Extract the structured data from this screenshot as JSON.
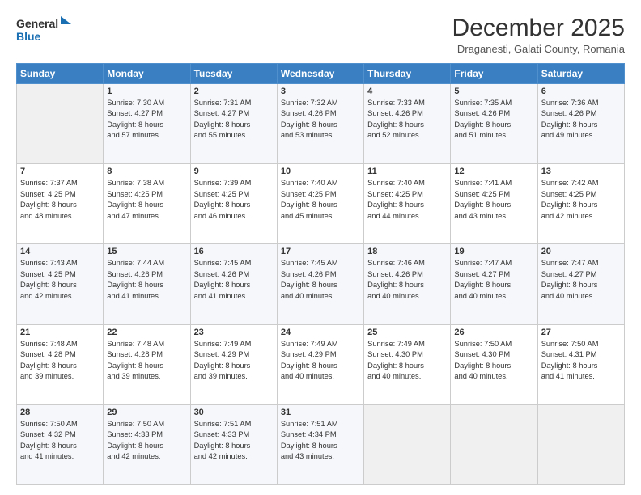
{
  "logo": {
    "line1": "General",
    "line2": "Blue"
  },
  "header": {
    "month": "December 2025",
    "location": "Draganesti, Galati County, Romania"
  },
  "weekdays": [
    "Sunday",
    "Monday",
    "Tuesday",
    "Wednesday",
    "Thursday",
    "Friday",
    "Saturday"
  ],
  "weeks": [
    [
      {
        "day": "",
        "content": ""
      },
      {
        "day": "1",
        "content": "Sunrise: 7:30 AM\nSunset: 4:27 PM\nDaylight: 8 hours\nand 57 minutes."
      },
      {
        "day": "2",
        "content": "Sunrise: 7:31 AM\nSunset: 4:27 PM\nDaylight: 8 hours\nand 55 minutes."
      },
      {
        "day": "3",
        "content": "Sunrise: 7:32 AM\nSunset: 4:26 PM\nDaylight: 8 hours\nand 53 minutes."
      },
      {
        "day": "4",
        "content": "Sunrise: 7:33 AM\nSunset: 4:26 PM\nDaylight: 8 hours\nand 52 minutes."
      },
      {
        "day": "5",
        "content": "Sunrise: 7:35 AM\nSunset: 4:26 PM\nDaylight: 8 hours\nand 51 minutes."
      },
      {
        "day": "6",
        "content": "Sunrise: 7:36 AM\nSunset: 4:26 PM\nDaylight: 8 hours\nand 49 minutes."
      }
    ],
    [
      {
        "day": "7",
        "content": "Sunrise: 7:37 AM\nSunset: 4:25 PM\nDaylight: 8 hours\nand 48 minutes."
      },
      {
        "day": "8",
        "content": "Sunrise: 7:38 AM\nSunset: 4:25 PM\nDaylight: 8 hours\nand 47 minutes."
      },
      {
        "day": "9",
        "content": "Sunrise: 7:39 AM\nSunset: 4:25 PM\nDaylight: 8 hours\nand 46 minutes."
      },
      {
        "day": "10",
        "content": "Sunrise: 7:40 AM\nSunset: 4:25 PM\nDaylight: 8 hours\nand 45 minutes."
      },
      {
        "day": "11",
        "content": "Sunrise: 7:40 AM\nSunset: 4:25 PM\nDaylight: 8 hours\nand 44 minutes."
      },
      {
        "day": "12",
        "content": "Sunrise: 7:41 AM\nSunset: 4:25 PM\nDaylight: 8 hours\nand 43 minutes."
      },
      {
        "day": "13",
        "content": "Sunrise: 7:42 AM\nSunset: 4:25 PM\nDaylight: 8 hours\nand 42 minutes."
      }
    ],
    [
      {
        "day": "14",
        "content": "Sunrise: 7:43 AM\nSunset: 4:25 PM\nDaylight: 8 hours\nand 42 minutes."
      },
      {
        "day": "15",
        "content": "Sunrise: 7:44 AM\nSunset: 4:26 PM\nDaylight: 8 hours\nand 41 minutes."
      },
      {
        "day": "16",
        "content": "Sunrise: 7:45 AM\nSunset: 4:26 PM\nDaylight: 8 hours\nand 41 minutes."
      },
      {
        "day": "17",
        "content": "Sunrise: 7:45 AM\nSunset: 4:26 PM\nDaylight: 8 hours\nand 40 minutes."
      },
      {
        "day": "18",
        "content": "Sunrise: 7:46 AM\nSunset: 4:26 PM\nDaylight: 8 hours\nand 40 minutes."
      },
      {
        "day": "19",
        "content": "Sunrise: 7:47 AM\nSunset: 4:27 PM\nDaylight: 8 hours\nand 40 minutes."
      },
      {
        "day": "20",
        "content": "Sunrise: 7:47 AM\nSunset: 4:27 PM\nDaylight: 8 hours\nand 40 minutes."
      }
    ],
    [
      {
        "day": "21",
        "content": "Sunrise: 7:48 AM\nSunset: 4:28 PM\nDaylight: 8 hours\nand 39 minutes."
      },
      {
        "day": "22",
        "content": "Sunrise: 7:48 AM\nSunset: 4:28 PM\nDaylight: 8 hours\nand 39 minutes."
      },
      {
        "day": "23",
        "content": "Sunrise: 7:49 AM\nSunset: 4:29 PM\nDaylight: 8 hours\nand 39 minutes."
      },
      {
        "day": "24",
        "content": "Sunrise: 7:49 AM\nSunset: 4:29 PM\nDaylight: 8 hours\nand 40 minutes."
      },
      {
        "day": "25",
        "content": "Sunrise: 7:49 AM\nSunset: 4:30 PM\nDaylight: 8 hours\nand 40 minutes."
      },
      {
        "day": "26",
        "content": "Sunrise: 7:50 AM\nSunset: 4:30 PM\nDaylight: 8 hours\nand 40 minutes."
      },
      {
        "day": "27",
        "content": "Sunrise: 7:50 AM\nSunset: 4:31 PM\nDaylight: 8 hours\nand 41 minutes."
      }
    ],
    [
      {
        "day": "28",
        "content": "Sunrise: 7:50 AM\nSunset: 4:32 PM\nDaylight: 8 hours\nand 41 minutes."
      },
      {
        "day": "29",
        "content": "Sunrise: 7:50 AM\nSunset: 4:33 PM\nDaylight: 8 hours\nand 42 minutes."
      },
      {
        "day": "30",
        "content": "Sunrise: 7:51 AM\nSunset: 4:33 PM\nDaylight: 8 hours\nand 42 minutes."
      },
      {
        "day": "31",
        "content": "Sunrise: 7:51 AM\nSunset: 4:34 PM\nDaylight: 8 hours\nand 43 minutes."
      },
      {
        "day": "",
        "content": ""
      },
      {
        "day": "",
        "content": ""
      },
      {
        "day": "",
        "content": ""
      }
    ]
  ]
}
